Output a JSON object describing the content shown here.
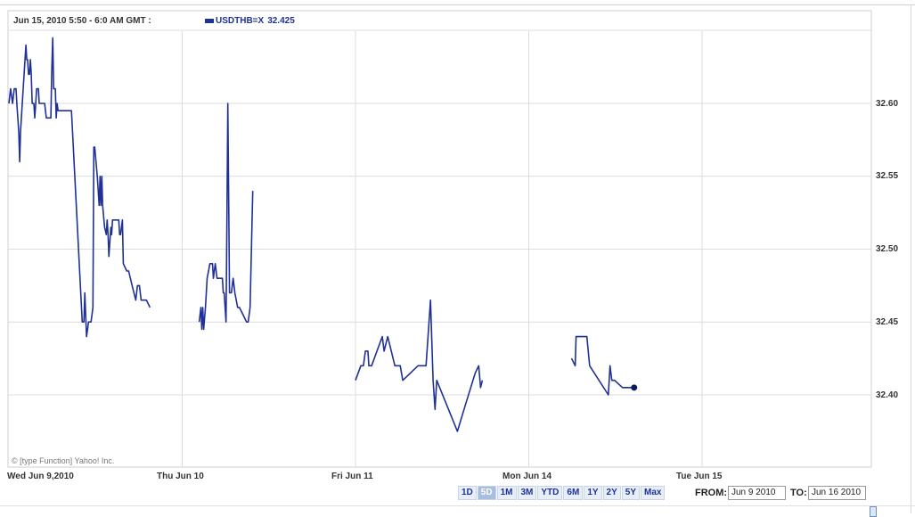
{
  "header": {
    "date_label": "Jun 15, 2010 5:50 - 6:0 AM GMT :",
    "series_label": "USDTHB=X",
    "series_value": "32.425"
  },
  "copyright": "© [type Function] Yahoo! Inc.",
  "colors": {
    "series": "#1f3196",
    "grid": "#dcdcdc",
    "text": "#333333"
  },
  "range_buttons": [
    {
      "label": "1D",
      "active": false
    },
    {
      "label": "5D",
      "active": true
    },
    {
      "label": "1M",
      "active": false
    },
    {
      "label": "3M",
      "active": false
    },
    {
      "label": "YTD",
      "active": false
    },
    {
      "label": "6M",
      "active": false
    },
    {
      "label": "1Y",
      "active": false
    },
    {
      "label": "2Y",
      "active": false
    },
    {
      "label": "5Y",
      "active": false
    },
    {
      "label": "Max",
      "active": false
    }
  ],
  "date_range": {
    "from_label": "FROM:",
    "from_value": "Jun 9 2010",
    "to_label": "TO:",
    "to_value": "Jun 16 2010"
  },
  "chart_data": {
    "type": "line",
    "title": "",
    "xlabel": "",
    "ylabel": "",
    "grid": true,
    "x_ticks": [
      "Wed Jun 9,2010",
      "Thu Jun 10",
      "Fri Jun 11",
      "Mon Jun 14",
      "Tue Jun 15"
    ],
    "y_ticks": [
      "32.40",
      "32.45",
      "32.50",
      "32.55",
      "32.60"
    ],
    "ylim": [
      32.35,
      32.65
    ],
    "x_unit": "trading days since Wed Jun 9",
    "series": [
      {
        "name": "USDTHB=X",
        "segments": [
          [
            [
              0.0,
              32.6
            ],
            [
              0.01,
              32.61
            ],
            [
              0.021,
              32.6
            ],
            [
              0.031,
              32.61
            ],
            [
              0.041,
              32.61
            ],
            [
              0.046,
              32.6
            ],
            [
              0.057,
              32.58
            ],
            [
              0.062,
              32.56
            ],
            [
              0.067,
              32.58
            ],
            [
              0.077,
              32.6
            ],
            [
              0.098,
              32.64
            ],
            [
              0.103,
              32.63
            ],
            [
              0.108,
              32.63
            ],
            [
              0.113,
              32.62
            ],
            [
              0.119,
              32.62
            ],
            [
              0.124,
              32.63
            ],
            [
              0.129,
              32.62
            ],
            [
              0.134,
              32.6
            ],
            [
              0.144,
              32.6
            ],
            [
              0.149,
              32.59
            ],
            [
              0.155,
              32.6
            ],
            [
              0.16,
              32.61
            ],
            [
              0.17,
              32.61
            ],
            [
              0.175,
              32.6
            ],
            [
              0.186,
              32.6
            ],
            [
              0.206,
              32.6
            ],
            [
              0.216,
              32.59
            ],
            [
              0.227,
              32.59
            ],
            [
              0.242,
              32.59
            ],
            [
              0.247,
              32.62
            ],
            [
              0.253,
              32.645
            ],
            [
              0.258,
              32.61
            ],
            [
              0.263,
              32.61
            ],
            [
              0.268,
              32.61
            ],
            [
              0.273,
              32.59
            ],
            [
              0.278,
              32.6
            ],
            [
              0.284,
              32.595
            ],
            [
              0.304,
              32.595
            ],
            [
              0.345,
              32.595
            ],
            [
              0.361,
              32.595
            ],
            [
              0.423,
              32.45
            ],
            [
              0.433,
              32.45
            ],
            [
              0.438,
              32.47
            ],
            [
              0.448,
              32.44
            ],
            [
              0.454,
              32.445
            ],
            [
              0.459,
              32.45
            ],
            [
              0.474,
              32.45
            ],
            [
              0.485,
              32.46
            ],
            [
              0.49,
              32.57
            ],
            [
              0.495,
              32.57
            ],
            [
              0.51,
              32.55
            ],
            [
              0.521,
              32.53
            ],
            [
              0.526,
              32.55
            ],
            [
              0.531,
              32.53
            ],
            [
              0.536,
              32.55
            ],
            [
              0.541,
              32.53
            ],
            [
              0.552,
              32.515
            ],
            [
              0.562,
              32.51
            ],
            [
              0.567,
              32.52
            ],
            [
              0.572,
              32.51
            ],
            [
              0.577,
              32.495
            ],
            [
              0.588,
              32.515
            ],
            [
              0.593,
              32.51
            ],
            [
              0.598,
              32.52
            ],
            [
              0.608,
              32.52
            ],
            [
              0.624,
              32.52
            ],
            [
              0.634,
              32.52
            ],
            [
              0.639,
              32.51
            ],
            [
              0.644,
              32.51
            ],
            [
              0.655,
              32.52
            ],
            [
              0.66,
              32.49
            ],
            [
              0.68,
              32.485
            ],
            [
              0.691,
              32.485
            ],
            [
              0.711,
              32.475
            ],
            [
              0.732,
              32.465
            ],
            [
              0.742,
              32.475
            ],
            [
              0.753,
              32.475
            ],
            [
              0.763,
              32.465
            ],
            [
              0.778,
              32.465
            ],
            [
              0.794,
              32.465
            ],
            [
              0.814,
              32.46
            ]
          ],
          [
            [
              1.098,
              32.45
            ],
            [
              1.108,
              32.46
            ],
            [
              1.113,
              32.445
            ],
            [
              1.119,
              32.46
            ],
            [
              1.124,
              32.445
            ],
            [
              1.134,
              32.46
            ],
            [
              1.144,
              32.48
            ],
            [
              1.16,
              32.49
            ],
            [
              1.175,
              32.49
            ],
            [
              1.18,
              32.48
            ],
            [
              1.191,
              32.49
            ],
            [
              1.201,
              32.48
            ],
            [
              1.216,
              32.48
            ],
            [
              1.232,
              32.48
            ],
            [
              1.237,
              32.47
            ],
            [
              1.242,
              32.47
            ],
            [
              1.253,
              32.45
            ],
            [
              1.258,
              32.52
            ],
            [
              1.263,
              32.6
            ],
            [
              1.268,
              32.54
            ],
            [
              1.273,
              32.47
            ],
            [
              1.284,
              32.47
            ],
            [
              1.294,
              32.48
            ],
            [
              1.304,
              32.47
            ],
            [
              1.32,
              32.46
            ],
            [
              1.33,
              32.46
            ],
            [
              1.351,
              32.455
            ],
            [
              1.371,
              32.45
            ],
            [
              1.381,
              32.45
            ],
            [
              1.392,
              32.46
            ],
            [
              1.407,
              32.54
            ]
          ],
          [
            [
              2.0,
              32.41
            ],
            [
              2.031,
              32.42
            ],
            [
              2.046,
              32.42
            ],
            [
              2.057,
              32.43
            ],
            [
              2.072,
              32.43
            ],
            [
              2.077,
              32.42
            ],
            [
              2.093,
              32.42
            ],
            [
              2.124,
              32.43
            ],
            [
              2.155,
              32.44
            ],
            [
              2.165,
              32.43
            ],
            [
              2.186,
              32.44
            ],
            [
              2.227,
              32.42
            ],
            [
              2.258,
              32.42
            ],
            [
              2.273,
              32.41
            ],
            [
              2.361,
              32.42
            ],
            [
              2.407,
              32.42
            ],
            [
              2.433,
              32.465
            ],
            [
              2.448,
              32.41
            ],
            [
              2.459,
              32.39
            ],
            [
              2.469,
              32.41
            ],
            [
              2.588,
              32.375
            ],
            [
              2.639,
              32.395
            ],
            [
              2.691,
              32.415
            ],
            [
              2.711,
              32.42
            ],
            [
              2.722,
              32.405
            ],
            [
              2.732,
              32.41
            ]
          ],
          [
            [
              3.247,
              32.425
            ],
            [
              3.268,
              32.42
            ],
            [
              3.273,
              32.44
            ],
            [
              3.283,
              32.44
            ],
            [
              3.304,
              32.44
            ],
            [
              3.335,
              32.44
            ],
            [
              3.351,
              32.42
            ],
            [
              3.459,
              32.4
            ],
            [
              3.469,
              32.42
            ],
            [
              3.479,
              32.41
            ],
            [
              3.495,
              32.41
            ],
            [
              3.541,
              32.405
            ],
            [
              3.572,
              32.405
            ],
            [
              3.608,
              32.405
            ]
          ]
        ],
        "last_point": [
          3.608,
          32.405
        ]
      }
    ]
  }
}
